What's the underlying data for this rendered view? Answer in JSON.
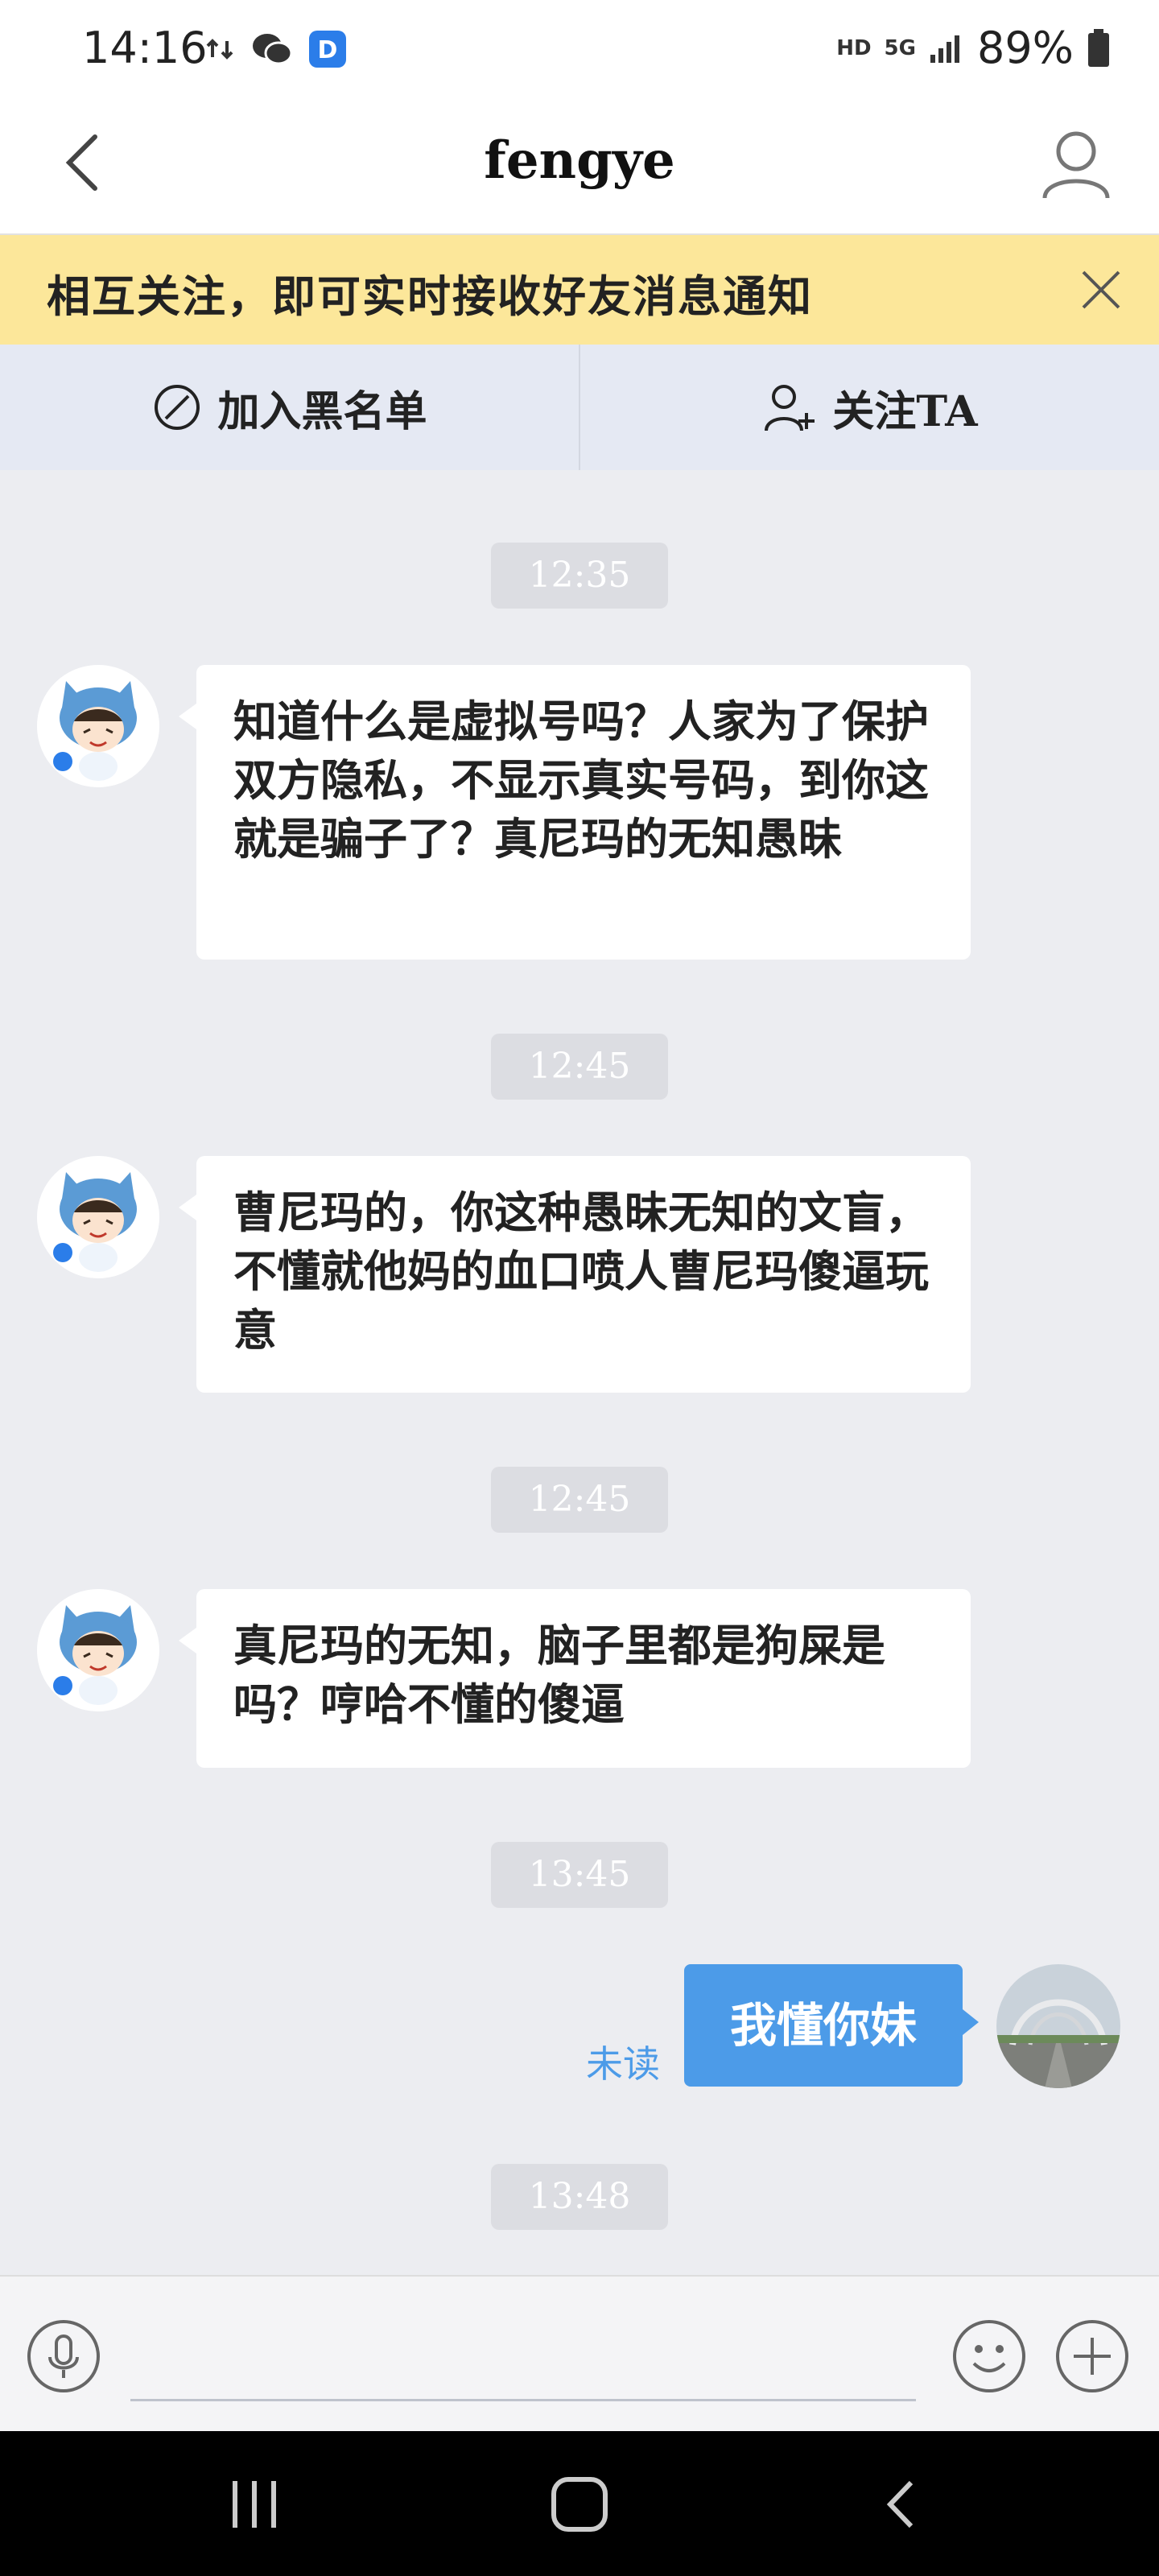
{
  "status_bar": {
    "time": "14:16",
    "hd": "HD",
    "network": "5G",
    "battery": "89%"
  },
  "header": {
    "title": "fengye"
  },
  "notice": {
    "text": "相互关注，即可实时接收好友消息通知"
  },
  "actions": {
    "blacklist_label": "加入黑名单",
    "follow_label": "关注TA"
  },
  "messages": [
    {
      "time": "12:35",
      "text": "知道什么是虚拟号吗？人家为了保护双方隐私，不显示真实号码，到你这就是骗子了？真尼玛的无知愚昧"
    },
    {
      "time": "12:45",
      "text": "曹尼玛的，你这种愚昧无知的文盲，不懂就他妈的血口喷人曹尼玛傻逼玩意"
    },
    {
      "time": "12:45",
      "text": "真尼玛的无知，脑子里都是狗屎是吗？哼哈不懂的傻逼"
    }
  ],
  "outgoing": {
    "time": "13:45",
    "text": "我懂你妹",
    "status": "未读"
  },
  "last_time": "13:48",
  "colors": {
    "accent": "#4c9be8",
    "notice_bg": "#fce79a",
    "chat_bg": "#ecedf1"
  }
}
